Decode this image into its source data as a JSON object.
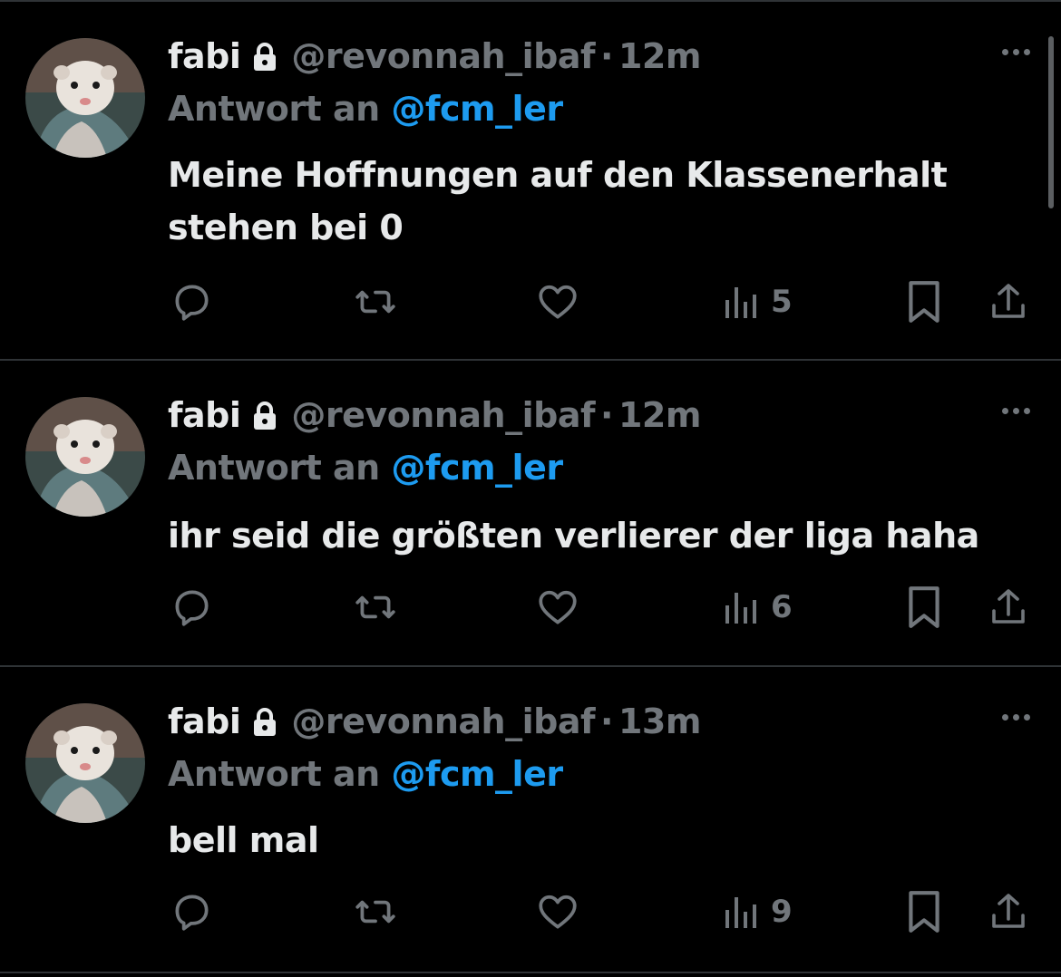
{
  "colors": {
    "background": "#000000",
    "primary_text": "#e7e9ea",
    "secondary_text": "#71767b",
    "link": "#1d9bf0",
    "divider": "#2f3336"
  },
  "icons": {
    "lock": "lock-icon",
    "more": "more-icon",
    "reply": "reply-icon",
    "retweet": "retweet-icon",
    "like": "heart-icon",
    "views": "views-icon",
    "bookmark": "bookmark-icon",
    "share": "share-icon"
  },
  "tweets": [
    {
      "name": "fabi",
      "handle": "@revonnah_ibaf",
      "separator": "·",
      "time": "12m",
      "reply_prefix": "Antwort an",
      "reply_target": "@fcm_ler",
      "text": "Meine Hoffnungen auf den Klassenerhalt stehen bei 0",
      "views": "5"
    },
    {
      "name": "fabi",
      "handle": "@revonnah_ibaf",
      "separator": "·",
      "time": "12m",
      "reply_prefix": "Antwort an",
      "reply_target": "@fcm_ler",
      "text": "ihr seid die größten verlierer der liga haha",
      "views": "6"
    },
    {
      "name": "fabi",
      "handle": "@revonnah_ibaf",
      "separator": "·",
      "time": "13m",
      "reply_prefix": "Antwort an",
      "reply_target": "@fcm_ler",
      "text": "bell mal",
      "views": "9"
    }
  ]
}
